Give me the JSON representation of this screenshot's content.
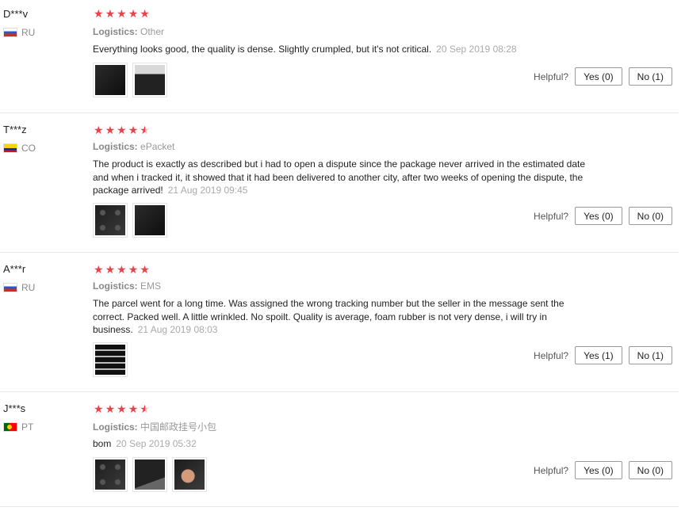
{
  "reviews": [
    {
      "user": "D***v",
      "country": "RU",
      "rating": 5,
      "logistics_label": "Logistics:",
      "logistics": "Other",
      "text": "Everything looks good, the quality is dense. Slightly crumpled, but it's not critical.",
      "date": "20 Sep 2019 08:28",
      "helpful_label": "Helpful?",
      "yes": "Yes (0)",
      "no": "No (1)"
    },
    {
      "user": "T***z",
      "country": "CO",
      "rating": 4.5,
      "logistics_label": "Logistics:",
      "logistics": "ePacket",
      "text": "The product is exactly as described but i had to open a dispute since the package never arrived in the estimated date and when i tracked it, it showed that it had been delivered to another city, after two weeks of opening the dispute, the package arrived!",
      "date": "21 Aug 2019 09:45",
      "helpful_label": "Helpful?",
      "yes": "Yes (0)",
      "no": "No (0)"
    },
    {
      "user": "A***r",
      "country": "RU",
      "rating": 5,
      "logistics_label": "Logistics:",
      "logistics": "EMS",
      "text": "The parcel went for a long time. Was assigned the wrong tracking number but the seller in the message sent the correct. Packed well. A little wrinkled. No spoilt. Quality is average, foam rubber is not very dense, i will try in business.",
      "date": "21 Aug 2019 08:03",
      "helpful_label": "Helpful?",
      "yes": "Yes (1)",
      "no": "No (1)"
    },
    {
      "user": "J***s",
      "country": "PT",
      "rating": 4.5,
      "logistics_label": "Logistics:",
      "logistics": "中国邮政挂号小包",
      "text": "bom",
      "date": "20 Sep 2019 05:32",
      "helpful_label": "Helpful?",
      "yes": "Yes (0)",
      "no": "No (0)"
    }
  ],
  "icons": {
    "star": "star-icon",
    "half_star": "half-star-icon",
    "flag": "flag-icon"
  },
  "colors": {
    "star": "#e8434b",
    "muted": "#999999",
    "text": "#222222",
    "border": "#e8e8e8"
  }
}
